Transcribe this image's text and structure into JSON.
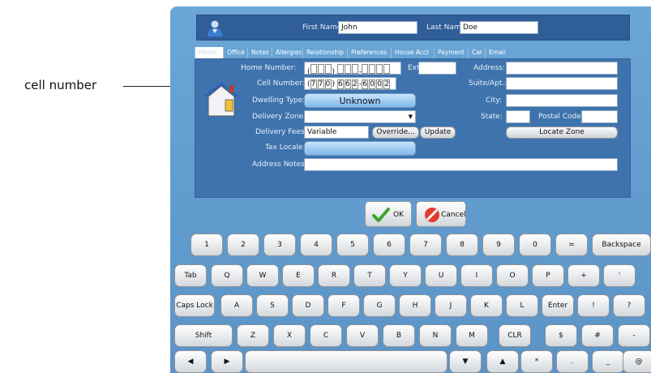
{
  "annotation": {
    "label": "cell number"
  },
  "header": {
    "first_name_label": "First Name:",
    "first_name_value": "John",
    "last_name_label": "Last Name:",
    "last_name_value": "Doe"
  },
  "tabs": [
    "Home",
    "Office",
    "Notes",
    "Allergies",
    "Relationship",
    "Preferences",
    "House Acct",
    "Payment",
    "Car",
    "Email"
  ],
  "form": {
    "home_number_label": "Home Number:",
    "ext_label": "Ext:",
    "cell_number_label": "Cell Number:",
    "cell_digits": [
      "7",
      "7",
      "0",
      "6",
      "6",
      "2",
      "6",
      "0",
      "0",
      "2"
    ],
    "dwelling_type_label": "Dwelling Type:",
    "dwelling_type_value": "Unknown",
    "delivery_zone_label": "Delivery Zone:",
    "delivery_fees_label": "Delivery Fees:",
    "delivery_fees_value": "Variable",
    "override_label": "Override...",
    "update_label": "Update",
    "tax_locale_label": "Tax Locale:",
    "address_notes_label": "Address Notes:",
    "address_label": "Address:",
    "suite_label": "Suite/Apt.:",
    "city_label": "City:",
    "state_label": "State:",
    "postal_code_label": "Postal Code:",
    "locate_zone_label": "Locate Zone"
  },
  "dialog": {
    "ok_label": "OK",
    "cancel_label": "Cancel"
  },
  "keyboard": {
    "row1": [
      "1",
      "2",
      "3",
      "4",
      "5",
      "6",
      "7",
      "8",
      "9",
      "0",
      "=",
      "Backspace"
    ],
    "row2": [
      "Tab",
      "Q",
      "W",
      "E",
      "R",
      "T",
      "Y",
      "U",
      "I",
      "O",
      "P",
      "+",
      "'"
    ],
    "row3": [
      "Caps Lock",
      "A",
      "S",
      "D",
      "F",
      "G",
      "H",
      "J",
      "K",
      "L",
      "Enter",
      "!",
      "?"
    ],
    "row4": [
      "Shift",
      "Z",
      "X",
      "C",
      "V",
      "B",
      "N",
      "M",
      "CLR",
      "$",
      "#",
      "-"
    ],
    "row5": [
      "◀",
      "▶",
      "",
      "▼",
      "▲",
      "*",
      ".",
      "_",
      "@"
    ]
  },
  "colors": {
    "window_bg": "#6aa6d6",
    "panel_bg": "#3f73ad",
    "header_bg": "#2f5e98"
  }
}
